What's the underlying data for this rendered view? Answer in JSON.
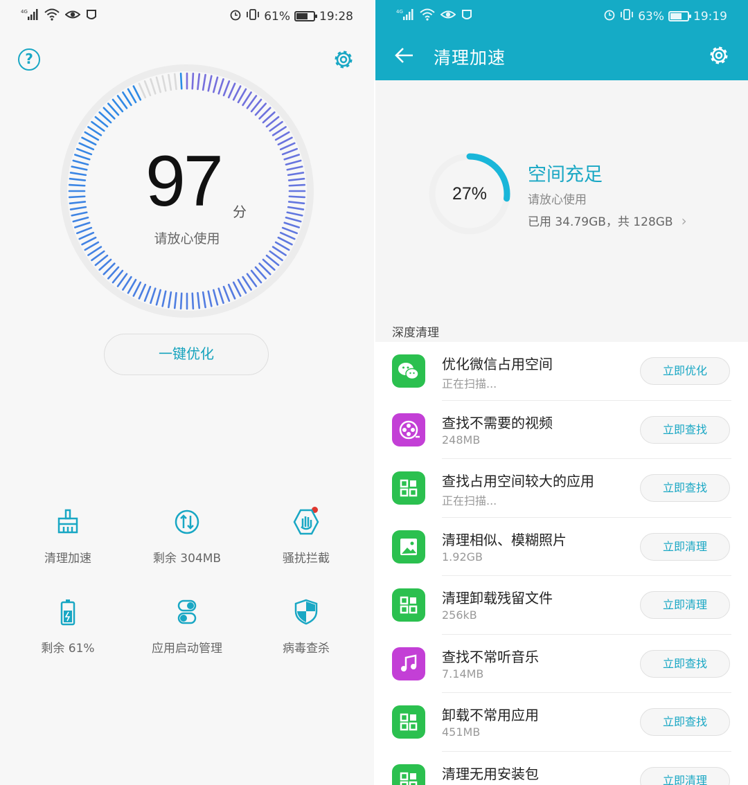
{
  "left": {
    "status": {
      "network": "4G",
      "battery": "61%",
      "time": "19:28"
    },
    "help_glyph": "?",
    "score": "97",
    "score_unit": "分",
    "score_text": "请放心使用",
    "score_value": 97,
    "optimize_label": "一键优化",
    "tiles": [
      {
        "label": "清理加速",
        "icon": "broom-icon"
      },
      {
        "label": "剩余 304MB",
        "icon": "memory-icon"
      },
      {
        "label": "骚扰拦截",
        "icon": "hand-block-icon",
        "badge": true
      },
      {
        "label": "剩余 61%",
        "icon": "battery-icon"
      },
      {
        "label": "应用启动管理",
        "icon": "toggle-icon"
      },
      {
        "label": "病毒查杀",
        "icon": "shield-icon"
      }
    ]
  },
  "right": {
    "status": {
      "network": "4G",
      "battery": "63%",
      "time": "19:19"
    },
    "title": "清理加速",
    "storage": {
      "percent_text": "27%",
      "percent": 27,
      "title": "空间充足",
      "subtitle": "请放心使用",
      "used": "已用 34.79GB，共 128GB"
    },
    "section": "深度清理",
    "items": [
      {
        "title": "优化微信占用空间",
        "sub": "正在扫描...",
        "action": "立即优化",
        "icon": "wechat-icon",
        "color": "#2bc04f"
      },
      {
        "title": "查找不需要的视频",
        "sub": "248MB",
        "action": "立即查找",
        "icon": "video-icon",
        "color": "#c33fd6"
      },
      {
        "title": "查找占用空间较大的应用",
        "sub": "正在扫描...",
        "action": "立即查找",
        "icon": "apps-grid-icon",
        "color": "#2bc04f"
      },
      {
        "title": "清理相似、模糊照片",
        "sub": "1.92GB",
        "action": "立即清理",
        "icon": "photo-icon",
        "color": "#2bc04f"
      },
      {
        "title": "清理卸载残留文件",
        "sub": "256kB",
        "action": "立即清理",
        "icon": "apps-grid-icon",
        "color": "#2bc04f"
      },
      {
        "title": "查找不常听音乐",
        "sub": "7.14MB",
        "action": "立即查找",
        "icon": "music-icon",
        "color": "#c33fd6"
      },
      {
        "title": "卸载不常用应用",
        "sub": "451MB",
        "action": "立即查找",
        "icon": "apps-grid-icon",
        "color": "#2bc04f"
      },
      {
        "title": "清理无用安装包",
        "sub": "",
        "action": "立即清理",
        "icon": "apps-grid-icon",
        "color": "#2bc04f"
      }
    ]
  },
  "colors": {
    "accent": "#19a7c4",
    "appbar": "#15abc6",
    "green": "#2bc04f",
    "purple": "#c33fd6"
  }
}
